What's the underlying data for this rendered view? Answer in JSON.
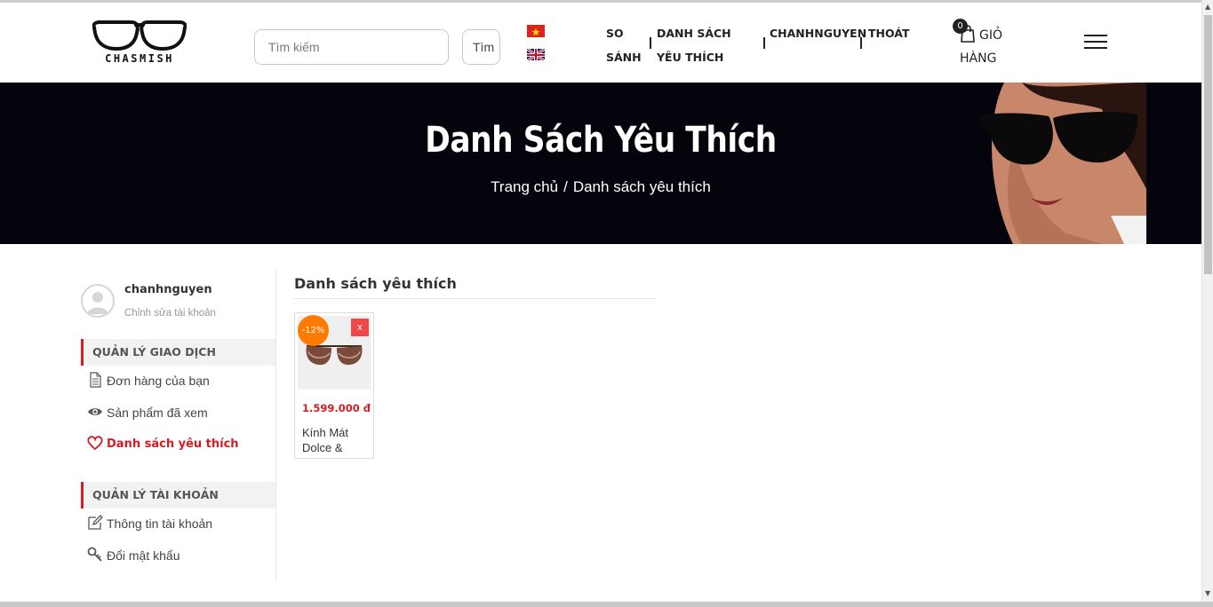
{
  "header": {
    "logo_text": "CHASMISH",
    "search_placeholder": "Tìm kiếm",
    "search_button": "Tìm",
    "nav": {
      "compare": "SO SÁNH",
      "wishlist": "DANH SÁCH YÊU THÍCH",
      "user": "CHANHNGUYEN",
      "logout": "THOÁT"
    },
    "cart": {
      "count": "0",
      "label": "GIỎ HÀNG"
    }
  },
  "banner": {
    "title": "Danh Sách Yêu Thích",
    "breadcrumb_home": "Trang chủ",
    "breadcrumb_sep": "/",
    "breadcrumb_current": "Danh sách yêu thích"
  },
  "sidebar": {
    "username": "chanhnguyen",
    "edit_account": "Chỉnh sửa tài khoản",
    "section_transactions": "QUẢN LÝ GIAO DỊCH",
    "items_transactions": [
      "Đơn hàng của bạn",
      "Sản phẩm đã xem",
      "Danh sách yêu thích"
    ],
    "section_account": "QUẢN LÝ TÀI KHOẢN",
    "items_account": [
      "Thông tin tài khoản",
      "Đổi mật khẩu"
    ]
  },
  "main": {
    "title": "Danh sách yêu thích",
    "products": [
      {
        "discount": "-12%",
        "remove": "x",
        "price": "1.599.000 đ",
        "name": "Kính Mát Dolce &"
      }
    ]
  },
  "colors": {
    "accent": "#d61c25",
    "discount": "#ff7a00",
    "banner_bg": "#05040d"
  },
  "icons": [
    "glasses-logo-icon",
    "vn-flag-icon",
    "uk-flag-icon",
    "cart-icon",
    "hamburger-icon",
    "document-icon",
    "eye-icon",
    "heart-icon",
    "edit-icon",
    "key-icon"
  ]
}
